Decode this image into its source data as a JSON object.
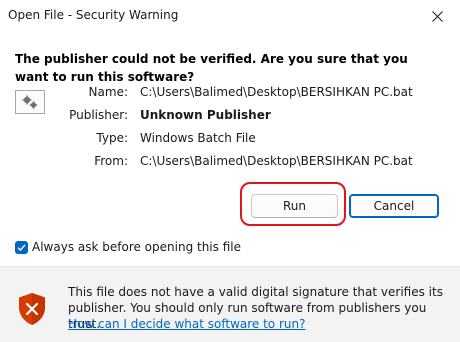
{
  "window": {
    "title": "Open File - Security Warning"
  },
  "question": "The publisher could not be verified. Are you sure that you want to run this software?",
  "details": {
    "name_label": "Name:",
    "name_value": "C:\\Users\\Balimed\\Desktop\\BERSIHKAN PC.bat",
    "publisher_label": "Publisher:",
    "publisher_value": "Unknown Publisher",
    "type_label": "Type:",
    "type_value": "Windows Batch File",
    "from_label": "From:",
    "from_value": "C:\\Users\\Balimed\\Desktop\\BERSIHKAN PC.bat"
  },
  "buttons": {
    "run_label": "Run",
    "cancel_label": "Cancel"
  },
  "checkbox": {
    "label": "Always ask before opening this file",
    "checked": true
  },
  "warning": {
    "text": "This file does not have a valid digital signature that verifies its publisher. You should only run software from publishers you trust.",
    "link_text": "How can I decide what software to run?"
  },
  "icons": {
    "file": "application-gears-icon",
    "shield": "security-shield-x-icon",
    "close": "close-icon"
  },
  "colors": {
    "accent": "#0067c0",
    "highlight": "#e0141b",
    "shield": "#d83b01"
  }
}
